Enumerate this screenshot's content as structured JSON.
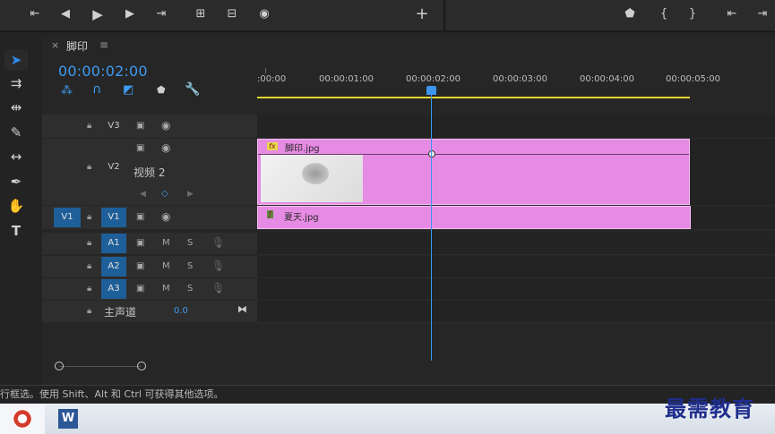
{
  "transport": {
    "icons": [
      "mark-in-icon",
      "step-back-icon",
      "play-icon",
      "step-forward-icon",
      "mark-out-icon",
      "insert-icon",
      "overwrite-icon",
      "export-frame-icon",
      "add-button-icon"
    ],
    "right_icons": [
      "marker-icon",
      "in-bracket-icon",
      "out-bracket-icon",
      "go-to-in-icon",
      "go-to-out-icon"
    ]
  },
  "tab": {
    "close": "×",
    "title": "脚印",
    "menu": "≡"
  },
  "timecode": "00:00:02:00",
  "ruler_labels": [
    ":00:00",
    "00:00:01:00",
    "00:00:02:00",
    "00:00:03:00",
    "00:00:04:00",
    "00:00:05:00"
  ],
  "tracks": {
    "v3": "V3",
    "v2": "V2",
    "v2_name": "视频 2",
    "v1_source": "V1",
    "v1": "V1",
    "a1": "A1",
    "a2": "A2",
    "a3": "A3",
    "mute": "M",
    "solo": "S",
    "master": "主声道",
    "master_value": "0.0"
  },
  "clips": {
    "v2_name": "脚印.jpg",
    "v2_fx": "fx",
    "v1_name": "夏天.jpg"
  },
  "status_text": "行框选。使用 Shift、Alt 和 Ctrl 可获得其他选项。",
  "brand": "最需教育",
  "colors": {
    "accent": "#3d95ec",
    "clip": "#e68be3",
    "track_blue": "#1f5f99"
  }
}
